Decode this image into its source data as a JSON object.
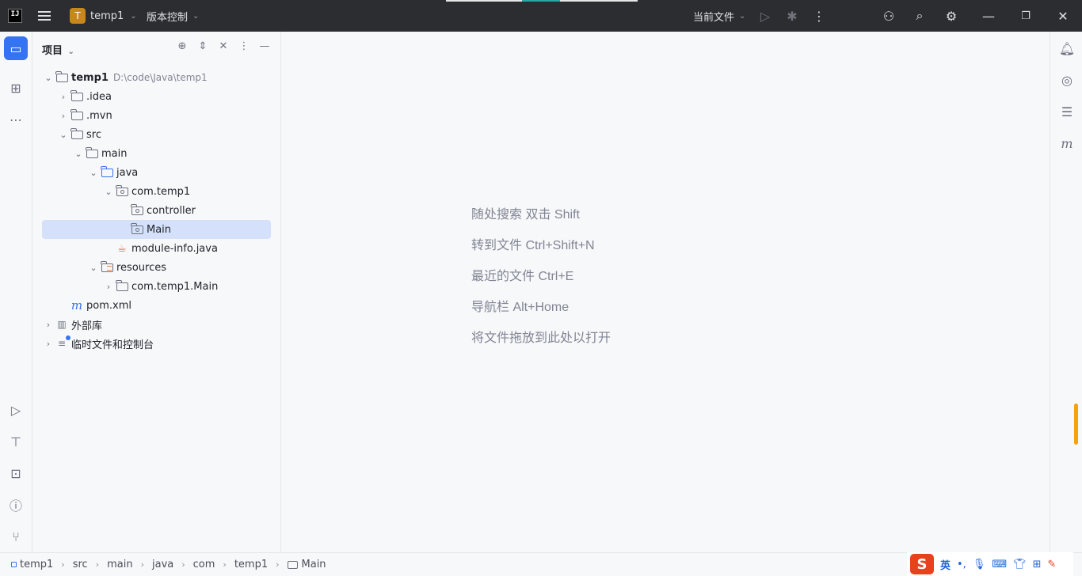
{
  "titlebar": {
    "app_logo": "IJ",
    "project_badge": "T",
    "project_name": "temp1",
    "vcs_label": "版本控制",
    "run_config": "当前文件"
  },
  "project_panel": {
    "title": "项目"
  },
  "tree": [
    {
      "label": "temp1",
      "path": "D:\\code\\Java\\temp1"
    },
    {
      "label": ".idea"
    },
    {
      "label": ".mvn"
    },
    {
      "label": "src"
    },
    {
      "label": "main"
    },
    {
      "label": "java"
    },
    {
      "label": "com.temp1"
    },
    {
      "label": "controller"
    },
    {
      "label": "Main"
    },
    {
      "label": "module-info.java"
    },
    {
      "label": "resources"
    },
    {
      "label": "com.temp1.Main"
    },
    {
      "label": "pom.xml"
    },
    {
      "label": "外部库"
    },
    {
      "label": "临时文件和控制台"
    }
  ],
  "editor_hints": [
    "随处搜索 双击 Shift",
    "转到文件 Ctrl+Shift+N",
    "最近的文件 Ctrl+E",
    "导航栏 Alt+Home",
    "将文件拖放到此处以打开"
  ],
  "breadcrumbs": [
    "temp1",
    "src",
    "main",
    "java",
    "com",
    "temp1",
    "Main"
  ],
  "ime": {
    "logo": "S",
    "mode": "英"
  },
  "colors": {
    "accent": "#3574f0",
    "titlebar_bg": "#2b2d30",
    "selection": "#d5e1fb",
    "warning": "#f5a20d"
  }
}
